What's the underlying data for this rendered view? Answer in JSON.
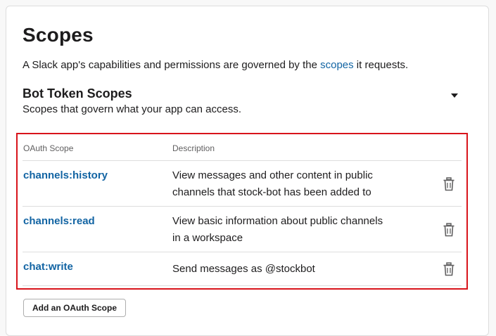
{
  "page": {
    "title": "Scopes",
    "description_prefix": "A Slack app's capabilities and permissions are governed by the ",
    "description_link": "scopes",
    "description_suffix": " it requests."
  },
  "bot_scopes": {
    "title": "Bot Token Scopes",
    "subtitle": "Scopes that govern what your app can access.",
    "columns": {
      "scope": "OAuth Scope",
      "description": "Description"
    },
    "rows": [
      {
        "scope": "channels:history",
        "desc_line1": "View messages and other content in public",
        "desc_line2": "channels that stock-bot has been added to"
      },
      {
        "scope": "channels:read",
        "desc_line1": "View basic information about public channels",
        "desc_line2": "in a workspace"
      },
      {
        "scope": "chat:write",
        "desc_line1": "Send messages as @stockbot",
        "desc_line2": ""
      }
    ],
    "add_button_label": "Add an OAuth Scope"
  },
  "colors": {
    "link": "#1264a3",
    "highlight_border": "#d8141b",
    "text": "#1d1c1d"
  },
  "icons": {
    "collapse": "caret-down-icon",
    "remove": "trash-icon"
  }
}
